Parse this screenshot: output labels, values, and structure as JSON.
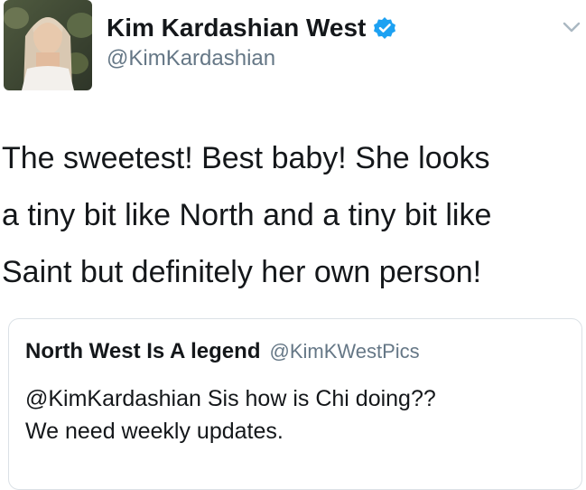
{
  "author": {
    "display_name": "Kim Kardashian West",
    "handle": "@KimKardashian",
    "verified": true,
    "avatar_icon": "profile-photo"
  },
  "tweet": {
    "lines": [
      "The sweetest! Best baby! She looks",
      "a tiny bit like North and a tiny bit like",
      "Saint but definitely her own person!"
    ]
  },
  "quoted_tweet": {
    "display_name": "North West Is A legend",
    "handle": "@KimKWestPics",
    "lines": [
      "@KimKardashian Sis how is Chi doing??",
      "We need weekly updates."
    ]
  },
  "icons": {
    "verified": "verified-badge-icon",
    "menu": "chevron-down-icon"
  },
  "colors": {
    "verified_blue": "#1da1f2",
    "text_primary": "#14171a",
    "text_secondary": "#657786",
    "border": "#dbe1e6"
  }
}
